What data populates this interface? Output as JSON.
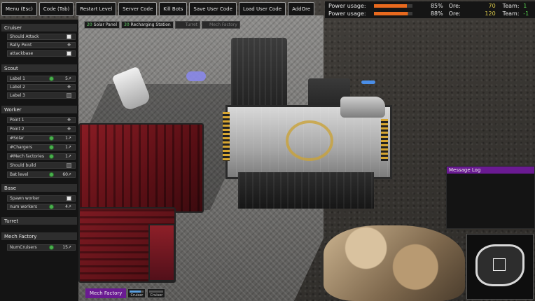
{
  "toolbar": {
    "menu": "Menu (Esc)",
    "code": "Code (Tab)",
    "restart": "Restart Level",
    "server_code": "Server Code",
    "kill_bots": "Kill Bots",
    "save_user_code": "Save User Code",
    "load_user_code": "Load User Code",
    "add_ore": "AddOre"
  },
  "status": {
    "rows": [
      {
        "label": "Power usage:",
        "percent": "85%",
        "ore_label": "Ore:",
        "ore": "70",
        "team_label": "Team:",
        "team": "1",
        "bar_fraction": 0.85
      },
      {
        "label": "Power usage:",
        "percent": "88%",
        "ore_label": "Ore:",
        "ore": "120",
        "team_label": "Team:",
        "team": "-1",
        "bar_fraction": 0.88
      }
    ],
    "bar_color": "#e8691e",
    "ore_color": "#d9c84a",
    "team_color": "#59d44f"
  },
  "left_panel": {
    "cruiser": {
      "title": "Cruiser",
      "rows": [
        {
          "label": "Should Attack",
          "control": "checkbox",
          "checked": true
        },
        {
          "label": "Rally Point",
          "control": "crosshair-icon"
        },
        {
          "label": "attackbase",
          "control": "checkbox",
          "checked": true
        }
      ]
    },
    "scout": {
      "title": "Scout",
      "rows": [
        {
          "label": "Label 1",
          "value": "5↗"
        },
        {
          "label": "Label 2",
          "control": "crosshair-icon"
        },
        {
          "label": "Label 3",
          "control": "checkbox",
          "checked": false
        }
      ]
    },
    "worker": {
      "title": "Worker",
      "rows": [
        {
          "label": "Point 1",
          "control": "crosshair-icon"
        },
        {
          "label": "Point 2",
          "control": "crosshair-icon"
        },
        {
          "label": "#Solar",
          "value": "1↗"
        },
        {
          "label": "#Chargers",
          "value": "1↗"
        },
        {
          "label": "#Mech factories",
          "value": "1↗"
        },
        {
          "label": "Should build",
          "control": "checkbox",
          "checked": false
        },
        {
          "label": "Bat level",
          "value": "60↗"
        }
      ]
    },
    "base": {
      "title": "Base",
      "rows": [
        {
          "label": "Spawn worker",
          "control": "checkbox",
          "checked": true
        },
        {
          "label": "num workers",
          "value": "4↗"
        }
      ]
    },
    "turret": {
      "title": "Turret"
    },
    "mech_factory": {
      "title": "Mech Factory",
      "rows": [
        {
          "label": "NumCruisers",
          "value": "15↗"
        }
      ]
    }
  },
  "buildbar": {
    "items": [
      {
        "num": "20",
        "label": "Solar Panel",
        "enabled": true
      },
      {
        "num": "30",
        "label": "Recharging Station",
        "enabled": true
      },
      {
        "num": "",
        "label": "Turret",
        "enabled": false
      },
      {
        "num": "",
        "label": "Mech Factory",
        "enabled": false
      }
    ]
  },
  "message_log": {
    "title": "Message Log",
    "header_color": "#6a1a92"
  },
  "factory_bar": {
    "title": "Mech Factory",
    "queue": [
      {
        "label": "Cruiser",
        "progress": 0.8
      },
      {
        "label": "Cruiser",
        "progress": 0.0
      }
    ]
  }
}
